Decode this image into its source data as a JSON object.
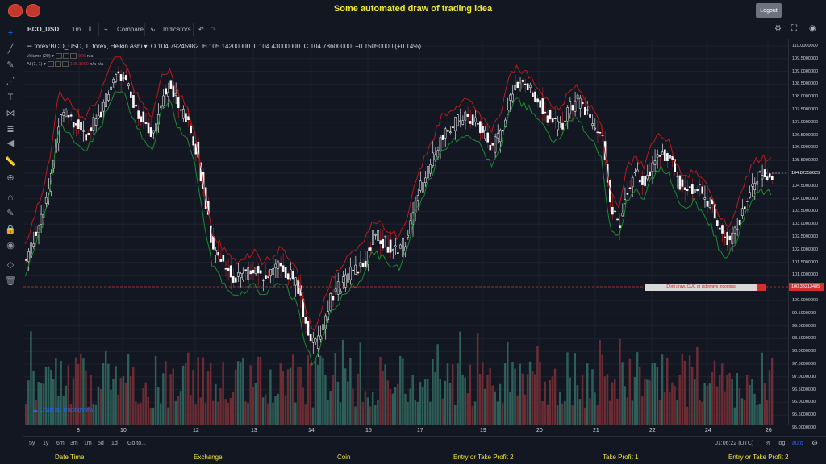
{
  "header": {
    "title": "Some automated draw of trading idea",
    "logout_label": "Logout"
  },
  "toolbar": {
    "symbol": "BCO_USD",
    "interval": "1m",
    "compare": "Compare",
    "indicators": "Indicators"
  },
  "legend": {
    "symbol_line": "forex:BCO_USD, 1, forex, Heikin Ashi",
    "open": "O 104.79245982",
    "high": "H 105.14200000",
    "low": "L 104.43000000",
    "close": "C 104.78600000",
    "change": "+0.15050000 (+0.14%)",
    "volume_label": "Volume (20)",
    "volume_value": "965",
    "volume_na": "n/a",
    "ai_label": "AI (1, 1)",
    "ai_value": "105.1000",
    "ai_na1": "n/a",
    "ai_na2": "n/a"
  },
  "price_axis": [
    "110.0000000",
    "109.5000000",
    "109.0000000",
    "108.5000000",
    "108.0000000",
    "107.5000000",
    "107.0000000",
    "106.5000000",
    "106.0000000",
    "105.5000000",
    "105.0000000",
    "104.5000000",
    "104.0000000",
    "103.5000000",
    "103.0000000",
    "102.5000000",
    "102.0000000",
    "101.5000000",
    "101.0000000",
    "100.5000000",
    "100.0000000",
    "99.5000000",
    "99.0000000",
    "98.5000000",
    "98.0000000",
    "97.5000000",
    "97.0000000",
    "96.5000000",
    "96.0000000",
    "95.5000000",
    "95.0000000"
  ],
  "current_price_label": "104.82355025",
  "line_price_label": "100.38213485",
  "annotation": {
    "text": "Dont draw. CUC or sideways incoming",
    "flag": "!"
  },
  "time_axis": [
    "8",
    "10",
    "12",
    "13",
    "14",
    "15",
    "17",
    "19",
    "20",
    "21",
    "22",
    "24",
    "26"
  ],
  "watermark": "Chart by TradingView",
  "bottombar": {
    "ranges": [
      "5y",
      "1y",
      "6m",
      "3m",
      "1m",
      "5d",
      "1d"
    ],
    "goto": "Go to...",
    "clock": "01:06:22 (UTC)",
    "percent": "%",
    "log": "log",
    "auto": "auto"
  },
  "footer": [
    "Date Time",
    "Exchange",
    "Coin",
    "Entry or Take Profit 2",
    "Take Profit 1",
    "Entry or Take Profit 2"
  ],
  "colors": {
    "up": "#26a69a",
    "down": "#ef5350",
    "accent": "#f2e635",
    "red_line": "#d32f2f"
  },
  "chart_data": {
    "type": "candlestick",
    "price_range": [
      95.0,
      110.0
    ],
    "price_path": [
      101.5,
      102.5,
      103.5,
      105,
      107.5,
      107.2,
      106.8,
      106.5,
      107,
      107.5,
      108.5,
      109,
      108.5,
      107.5,
      107,
      106.5,
      108,
      108.5,
      107.5,
      107,
      106,
      104,
      102,
      101.5,
      101,
      100.8,
      101,
      101.2,
      100.7,
      101,
      101.3,
      101,
      100.5,
      99,
      98,
      99,
      100,
      100.5,
      101,
      101.2,
      101.5,
      102.5,
      102.3,
      102,
      101.8,
      102.5,
      104,
      104.8,
      105.5,
      106.5,
      106.8,
      107,
      107.2,
      107,
      106.5,
      106,
      106.5,
      108,
      108.5,
      108.3,
      108,
      107.5,
      107,
      106.8,
      107.5,
      107.8,
      107.3,
      106.8,
      106.2,
      103.5,
      103,
      104.5,
      105,
      104.5,
      105.5,
      105.8,
      105.5,
      104.5,
      104.2,
      104.5,
      104,
      103.5,
      102.5,
      102.3,
      103,
      104,
      104.8,
      104.9,
      104.8
    ]
  }
}
